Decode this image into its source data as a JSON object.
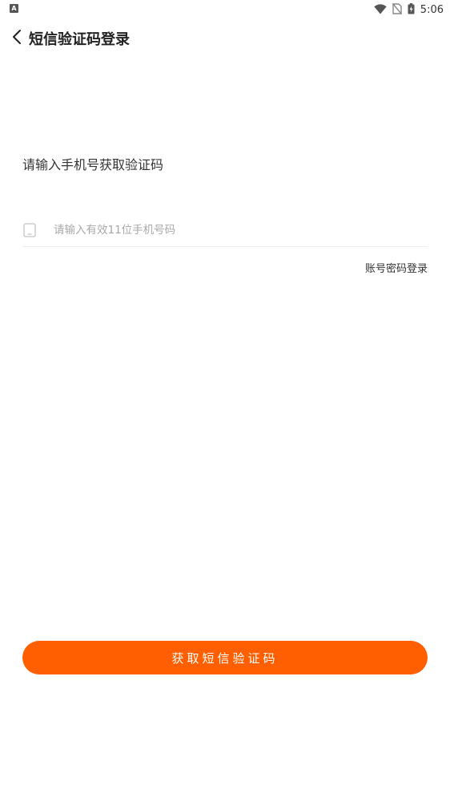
{
  "status_bar": {
    "left_badge": "A",
    "time": "5:06"
  },
  "header": {
    "back_icon": "chevron-left-icon",
    "title": "短信验证码登录"
  },
  "main": {
    "prompt": "请输入手机号获取验证码",
    "phone_field": {
      "icon": "phone-icon",
      "placeholder": "请输入有效11位手机号码",
      "value": ""
    },
    "password_login_link": "账号密码登录",
    "sms_button_label": "获取短信验证码"
  },
  "colors": {
    "accent": "#ff5f00",
    "background": "#ffffff"
  }
}
